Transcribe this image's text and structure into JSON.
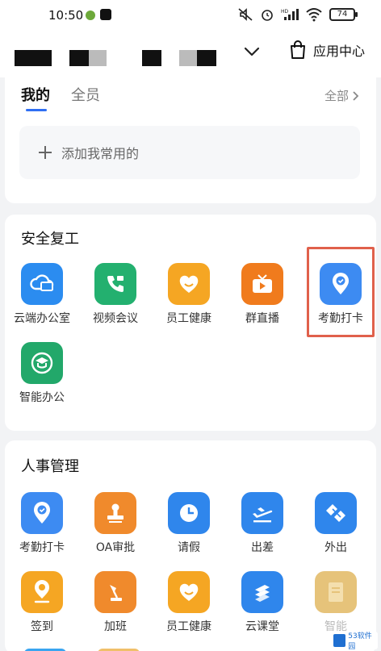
{
  "status_bar": {
    "time": "10:50",
    "battery": "74",
    "signal_label": "HD"
  },
  "header": {
    "app_center_label": "应用中心"
  },
  "my_apps": {
    "tabs": [
      {
        "label": "我的",
        "active": true
      },
      {
        "label": "全员",
        "active": false
      }
    ],
    "all_label": "全部",
    "add_label": "添加我常用的"
  },
  "section_safe_return": {
    "title": "安全复工",
    "apps": [
      {
        "label": "云端办公室",
        "icon": "cloud-desktop-icon",
        "color": "#2b8cf0"
      },
      {
        "label": "视频会议",
        "icon": "video-call-icon",
        "color": "#23b06f"
      },
      {
        "label": "员工健康",
        "icon": "heart-smile-icon",
        "color": "#f5a623"
      },
      {
        "label": "群直播",
        "icon": "tv-play-icon",
        "color": "#f07b1d"
      },
      {
        "label": "考勤打卡",
        "icon": "location-check-icon",
        "color": "#3d8bf2"
      },
      {
        "label": "智能办公",
        "icon": "smart-office-icon",
        "color": "#22a86a"
      }
    ]
  },
  "section_hr": {
    "title": "人事管理",
    "apps": [
      {
        "label": "考勤打卡",
        "icon": "location-check-icon",
        "color": "#3d8bf2"
      },
      {
        "label": "OA审批",
        "icon": "stamp-icon",
        "color": "#f08a2c"
      },
      {
        "label": "请假",
        "icon": "clock-icon",
        "color": "#2f86ec"
      },
      {
        "label": "出差",
        "icon": "airplane-icon",
        "color": "#2f86ec"
      },
      {
        "label": "外出",
        "icon": "handshake-icon",
        "color": "#2f86ec"
      },
      {
        "label": "签到",
        "icon": "location-smile-icon",
        "color": "#f5a623"
      },
      {
        "label": "加班",
        "icon": "desk-lamp-icon",
        "color": "#f08a2c"
      },
      {
        "label": "员工健康",
        "icon": "heart-smile-icon",
        "color": "#f5a623"
      },
      {
        "label": "云课堂",
        "icon": "layers-icon",
        "color": "#2f86ec"
      },
      {
        "label": "智能",
        "icon": "document-icon",
        "color": "#e6c37a"
      }
    ]
  },
  "watermark": {
    "text": "53软件园"
  }
}
